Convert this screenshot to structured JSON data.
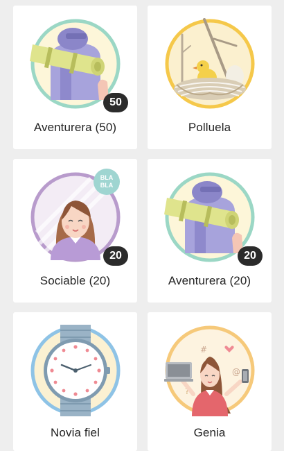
{
  "badges": [
    {
      "label": "Aventurera (50)",
      "count": "50",
      "icon": "backpack-adventurer-icon",
      "ring_color": "#9bd7c5"
    },
    {
      "label": "Polluela",
      "icon": "chick-nest-icon",
      "ring_color": "#f5c84a"
    },
    {
      "label": "Sociable (20)",
      "count": "20",
      "icon": "sociable-girl-icon",
      "ring_color": "#b89bcc",
      "bubble_text_1": "BLA",
      "bubble_text_2": "BLA"
    },
    {
      "label": "Aventurera (20)",
      "count": "20",
      "icon": "backpack-adventurer-icon",
      "ring_color": "#9bd7c5"
    },
    {
      "label": "Novia fiel",
      "icon": "wristwatch-icon",
      "ring_color": "#8ec3e6"
    },
    {
      "label": "Genia",
      "icon": "genius-girl-icon",
      "ring_color": "#f6c97a"
    }
  ]
}
